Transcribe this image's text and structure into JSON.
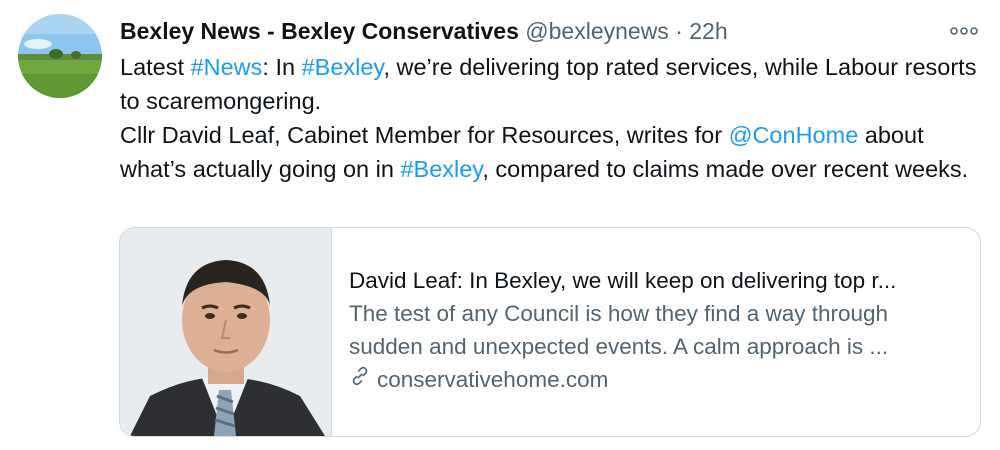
{
  "tweet": {
    "display_name": "Bexley News - Bexley Conservatives",
    "handle": "@bexleynews",
    "separator": "·",
    "time": "22h",
    "line1": {
      "t1": "Latest ",
      "tag_news": "#News",
      "t2": ": In ",
      "tag_bexley": "#Bexley",
      "t3": ", we’re delivering top rated services, while Labour resorts to scaremongering."
    },
    "line2": {
      "t1": "Cllr David Leaf, Cabinet Member for Resources, writes for ",
      "mention": "@ConHome",
      "t2": " about what’s actually going on in ",
      "tag_bexley": "#Bexley",
      "t3": ", compared to claims made over recent weeks."
    }
  },
  "card": {
    "title": "David Leaf: In Bexley, we will keep on delivering top r...",
    "description_line1": "The test of any Council is how they find a way through",
    "description_line2": "sudden and unexpected events. A calm approach is ...",
    "domain": "conservativehome.com"
  },
  "icons": {
    "more": "more-options-icon",
    "link": "link-icon"
  },
  "colors": {
    "link": "#1d9bf0",
    "secondary_text": "#536471",
    "border": "#cfd9de"
  }
}
